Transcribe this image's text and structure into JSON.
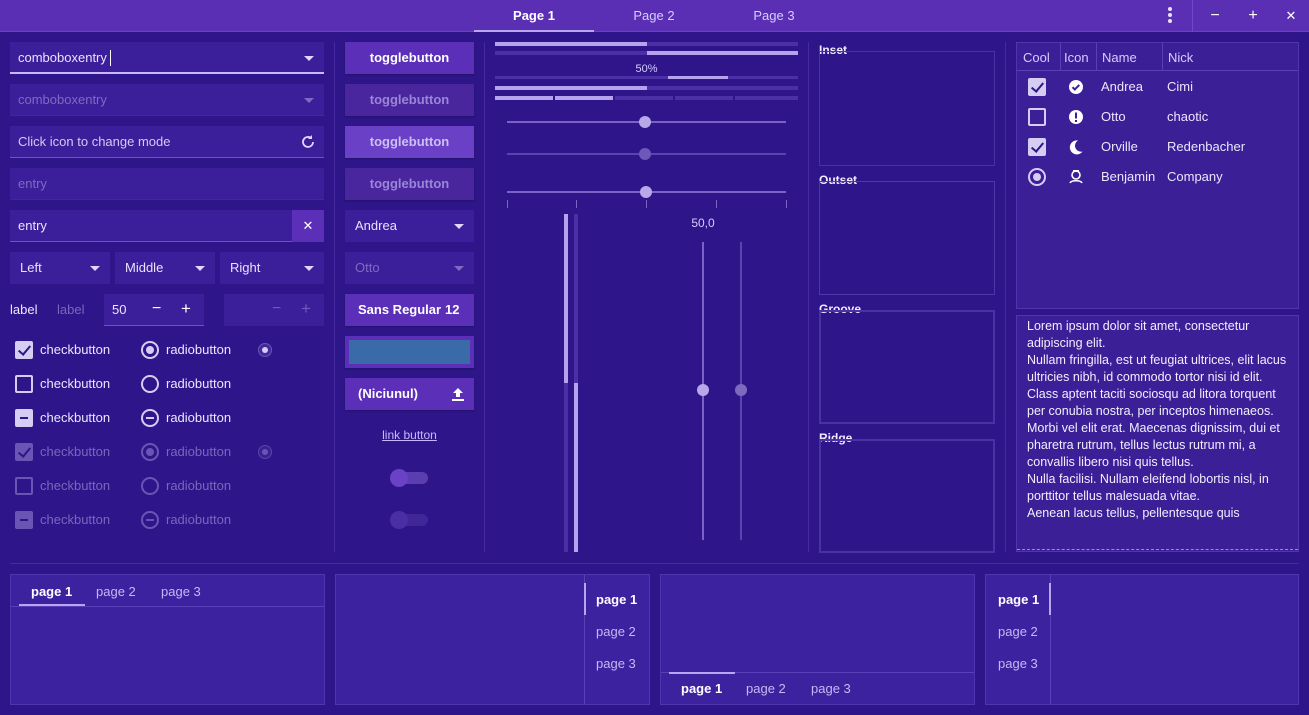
{
  "header": {
    "tabs": [
      "Page 1",
      "Page 2",
      "Page 3"
    ],
    "active_tab": 0,
    "window_buttons": {
      "minimize": "−",
      "maximize": "+",
      "close": "✕"
    }
  },
  "left": {
    "combo1": "comboboxentry",
    "combo2": "comboboxentry",
    "entry_mode_placeholder": "Click icon to change mode",
    "entry_disabled": "entry",
    "entry_clearable": "entry",
    "clear_icon": "✕",
    "align_combos": [
      "Left",
      "Middle",
      "Right"
    ],
    "label1": "label",
    "label2": "label",
    "spin_value": "50",
    "spin_minus": "−",
    "spin_plus": "+",
    "check_label": "checkbutton",
    "radio_label": "radiobutton"
  },
  "buttons": {
    "toggle": "togglebutton",
    "combo_andrea": "Andrea",
    "combo_otto": "Otto",
    "font_name": "Sans Regular",
    "font_size": "12",
    "file_button": "(Niciunul)",
    "link": "link button",
    "color_hex": "#3b6aa8"
  },
  "sliders": {
    "progress_text": "50%",
    "scale_value": "50,0",
    "level": 0.5
  },
  "frames": [
    "Inset",
    "Outset",
    "Groove",
    "Ridge"
  ],
  "tree": {
    "columns": [
      "Cool",
      "Icon",
      "Name",
      "Nick"
    ],
    "rows": [
      {
        "cool": "checked",
        "icon": "check-circle-icon",
        "name": "Andrea",
        "nick": "Cimi"
      },
      {
        "cool": "unchecked",
        "icon": "alert-icon",
        "name": "Otto",
        "nick": "chaotic"
      },
      {
        "cool": "checked",
        "icon": "moon-icon",
        "name": "Orville",
        "nick": "Redenbacher"
      },
      {
        "cool": "radio",
        "icon": "person-icon",
        "name": "Benjamin",
        "nick": "Company"
      }
    ]
  },
  "text_view": "Lorem ipsum dolor sit amet, consectetur adipiscing elit.\nNullam fringilla, est ut feugiat ultrices, elit lacus ultricies nibh, id commodo tortor nisi id elit.\nClass aptent taciti sociosqu ad litora torquent per conubia nostra, per inceptos himenaeos.\nMorbi vel elit erat. Maecenas dignissim, dui et pharetra rutrum, tellus lectus rutrum mi, a convallis libero nisi quis tellus.\nNulla facilisi. Nullam eleifend lobortis nisl, in porttitor tellus malesuada vitae.\nAenean lacus tellus, pellentesque quis",
  "notebooks": {
    "tabs": [
      "page 1",
      "page 2",
      "page 3"
    ]
  },
  "colors": {
    "window_bg": "#2e168a",
    "header_bg": "#5a2fb3",
    "accent": "#b9a6f0"
  }
}
